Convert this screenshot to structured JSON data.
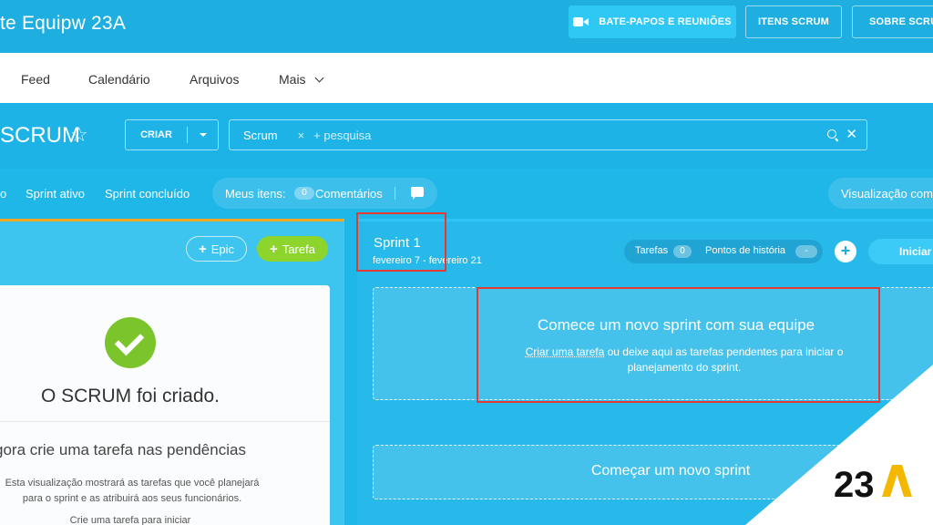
{
  "header": {
    "team_title": "te Equipw 23A",
    "buttons": {
      "video": "BATE-PAPOS E REUNIÕES",
      "items": "ITENS SCRUM",
      "about": "SOBRE SCRUM"
    }
  },
  "nav": {
    "items": [
      "Feed",
      "Calendário",
      "Arquivos",
      "Mais"
    ]
  },
  "scrum_bar": {
    "title": "SCRUM",
    "create_label": "CRIAR",
    "search_tag": "Scrum",
    "search_placeholder": "+ pesquisa"
  },
  "tabs": {
    "partial": "o",
    "active_sprint": "Sprint ativo",
    "completed_sprint": "Sprint concluído",
    "my_items_label": "Meus itens:",
    "comments_count": "0",
    "comments_label": "Comentários",
    "view_label": "Visualização comp"
  },
  "backlog": {
    "epic_label": "Epic",
    "task_label": "Tarefa",
    "created_title": "O SCRUM foi criado.",
    "create_task_heading": "gora crie uma tarefa nas pendências",
    "description": "Esta visualização mostrará as tarefas que você planejará para o sprint e as atribuirá aos seus funcionários.",
    "hint": "Crie uma tarefa para iniciar"
  },
  "sprint": {
    "name": "Sprint 1",
    "dates": "fevereiro 7 - fevereiro 21",
    "tasks_label": "Tarefas",
    "tasks_count": "0",
    "story_points_label": "Pontos de história",
    "story_points_value": "-",
    "start_label": "Iniciar",
    "drop_title": "Comece um novo sprint com sua equipe",
    "drop_link": "Criar uma tarefa",
    "drop_desc_rest": " ou deixe aqui as tarefas pendentes para iniciar o planejamento do sprint.",
    "new_sprint_label": "Começar um novo sprint"
  },
  "watermark": {
    "logo_text": "23A",
    "colors": {
      "black": "#111111",
      "yellow": "#f5b800"
    }
  },
  "colors": {
    "background": "#1fb6e8",
    "highlight": "#e53935",
    "success": "#7cc42b",
    "accent_orange": "#f5a623"
  }
}
